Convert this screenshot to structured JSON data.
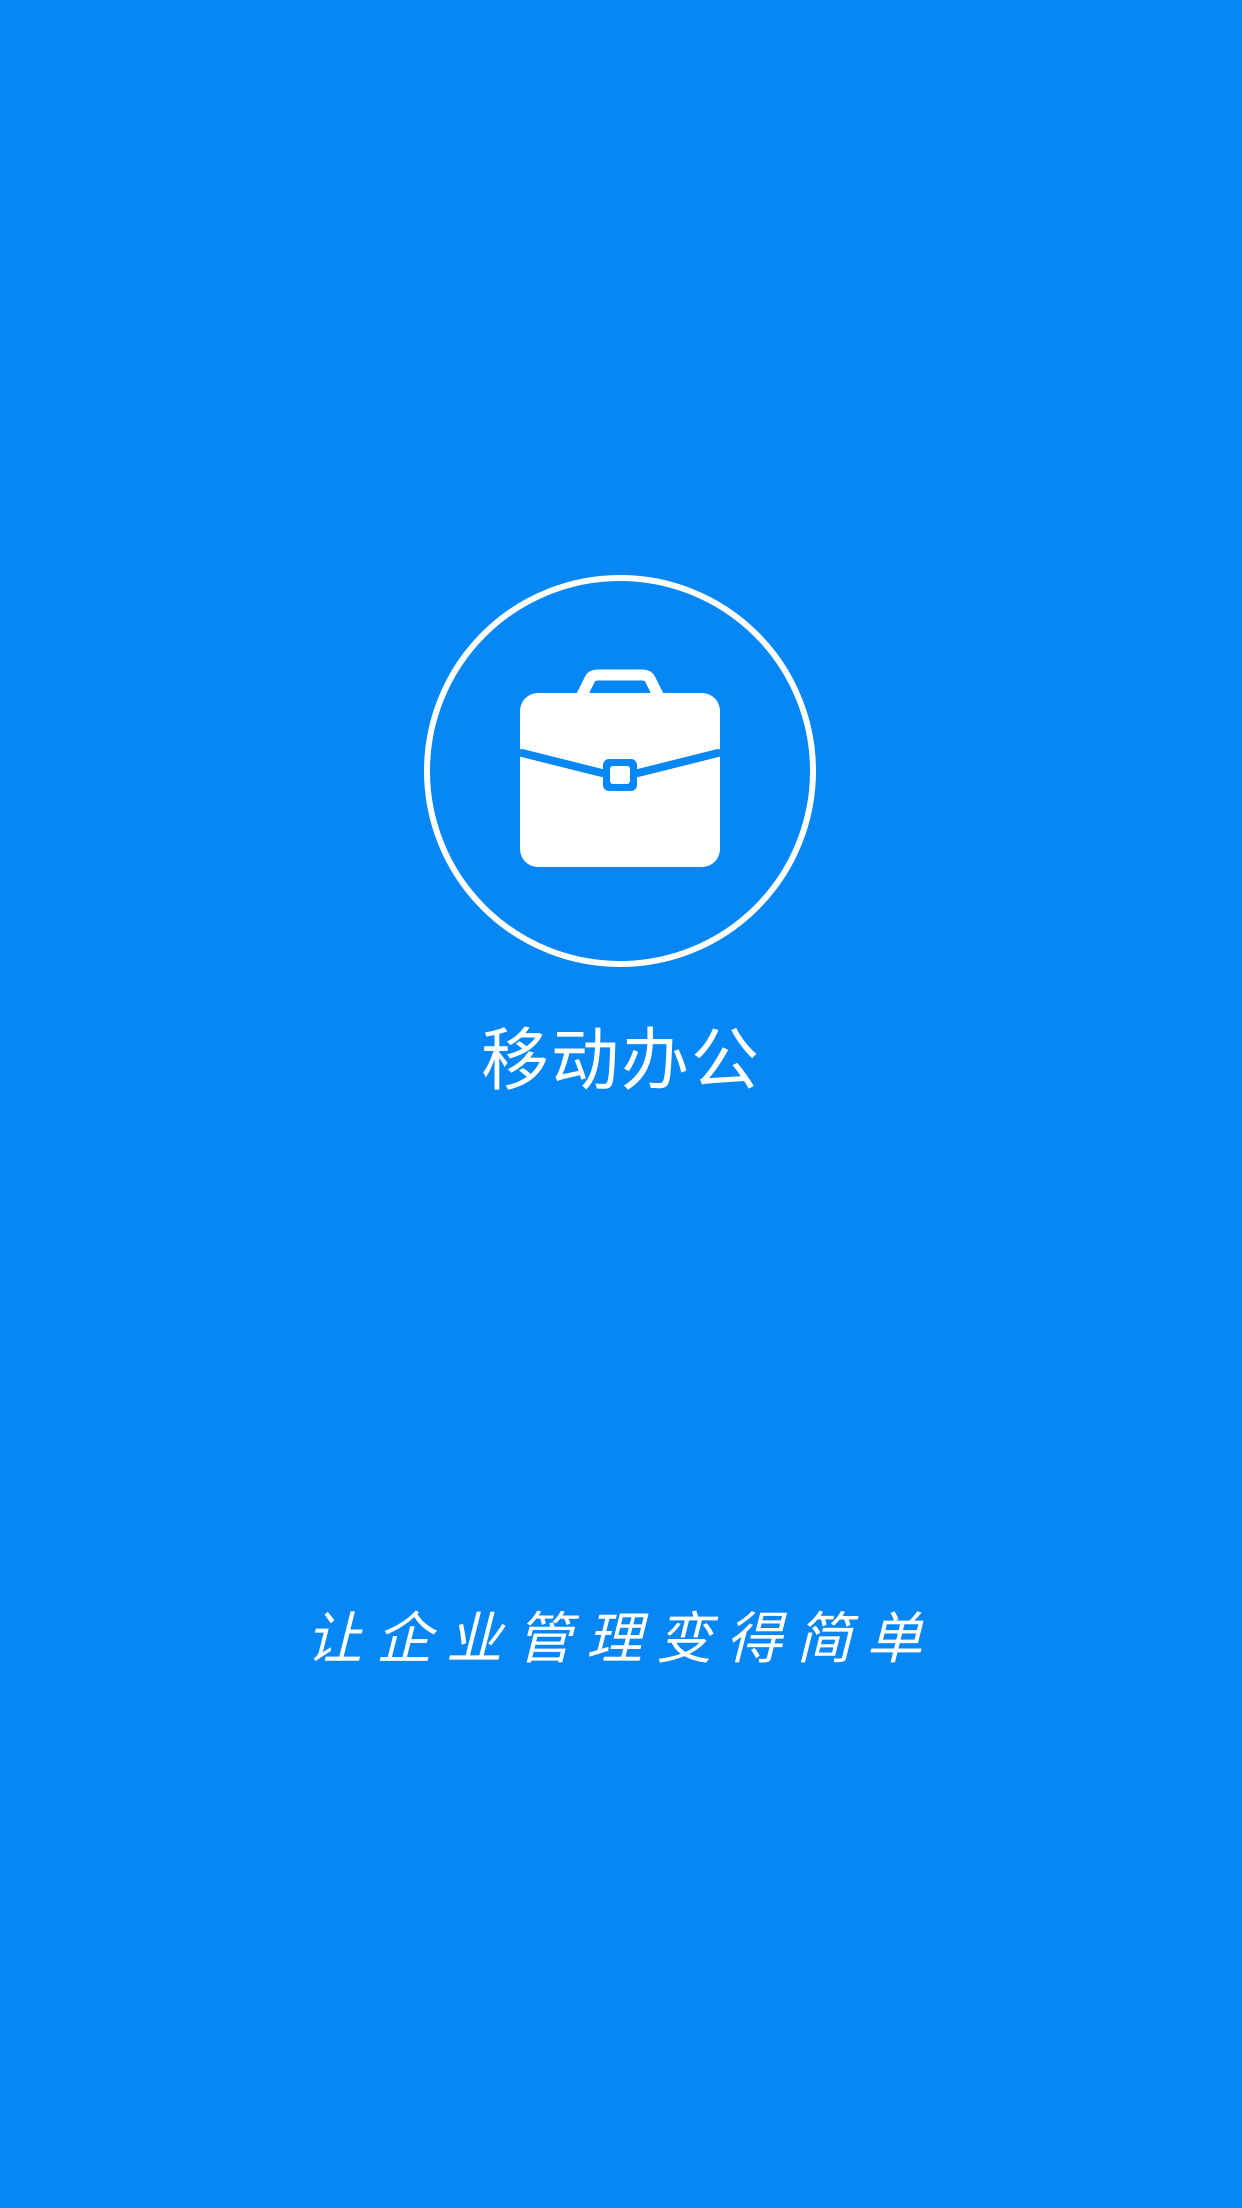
{
  "theme": {
    "background": "#0787F5",
    "foreground": "#FFFFFF"
  },
  "logo": {
    "icon": "briefcase-icon"
  },
  "app_title": "移动办公",
  "slogan": "让企业管理变得简单"
}
